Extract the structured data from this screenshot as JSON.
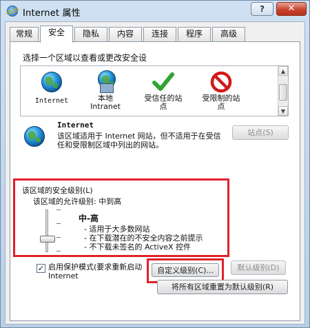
{
  "window": {
    "title": "Internet 属性",
    "help_label": "?",
    "close_label": "✕"
  },
  "tabs": [
    {
      "label": "常规",
      "active": false
    },
    {
      "label": "安全",
      "active": true
    },
    {
      "label": "隐私",
      "active": false
    },
    {
      "label": "内容",
      "active": false
    },
    {
      "label": "连接",
      "active": false
    },
    {
      "label": "程序",
      "active": false
    },
    {
      "label": "高级",
      "active": false
    }
  ],
  "security": {
    "zone_heading": "选择一个区域以查看或更改安全设",
    "zones": [
      {
        "label": "Internet",
        "icon": "globe-icon"
      },
      {
        "label": "本地\nIntranet",
        "icon": "local-intranet-icon"
      },
      {
        "label": "受信任的站\n点",
        "icon": "checkmark-icon"
      },
      {
        "label": "受限制的站\n点",
        "icon": "restricted-icon"
      }
    ],
    "scroll_up_label": "▲",
    "scroll_down_label": "▼",
    "selected_zone": {
      "title": "Internet",
      "description": "该区域适用于 Internet 网站，但不适用于在受信任和受限制区域中列出的网站。"
    },
    "sites_button_label": "站点(S)",
    "level_group": {
      "title": "该区域的安全级别(L)",
      "allowed": "该区域的允许级别: 中到高",
      "level_name": "中-高",
      "bullets": [
        "- 适用于大多数网站",
        "- 在下载潜在的不安全内容之前提示",
        "- 不下载未签名的 ActiveX 控件"
      ]
    },
    "protected_mode_checked": true,
    "protected_mode_check_mark": "✓",
    "protected_mode_label": "启用保护模式(要求重新启动 Internet",
    "custom_level_button_label": "自定义级别(C)...",
    "default_level_button_label": "默认级别(D)",
    "reset_all_button_label": "将所有区域重置为默认级别(R)"
  }
}
